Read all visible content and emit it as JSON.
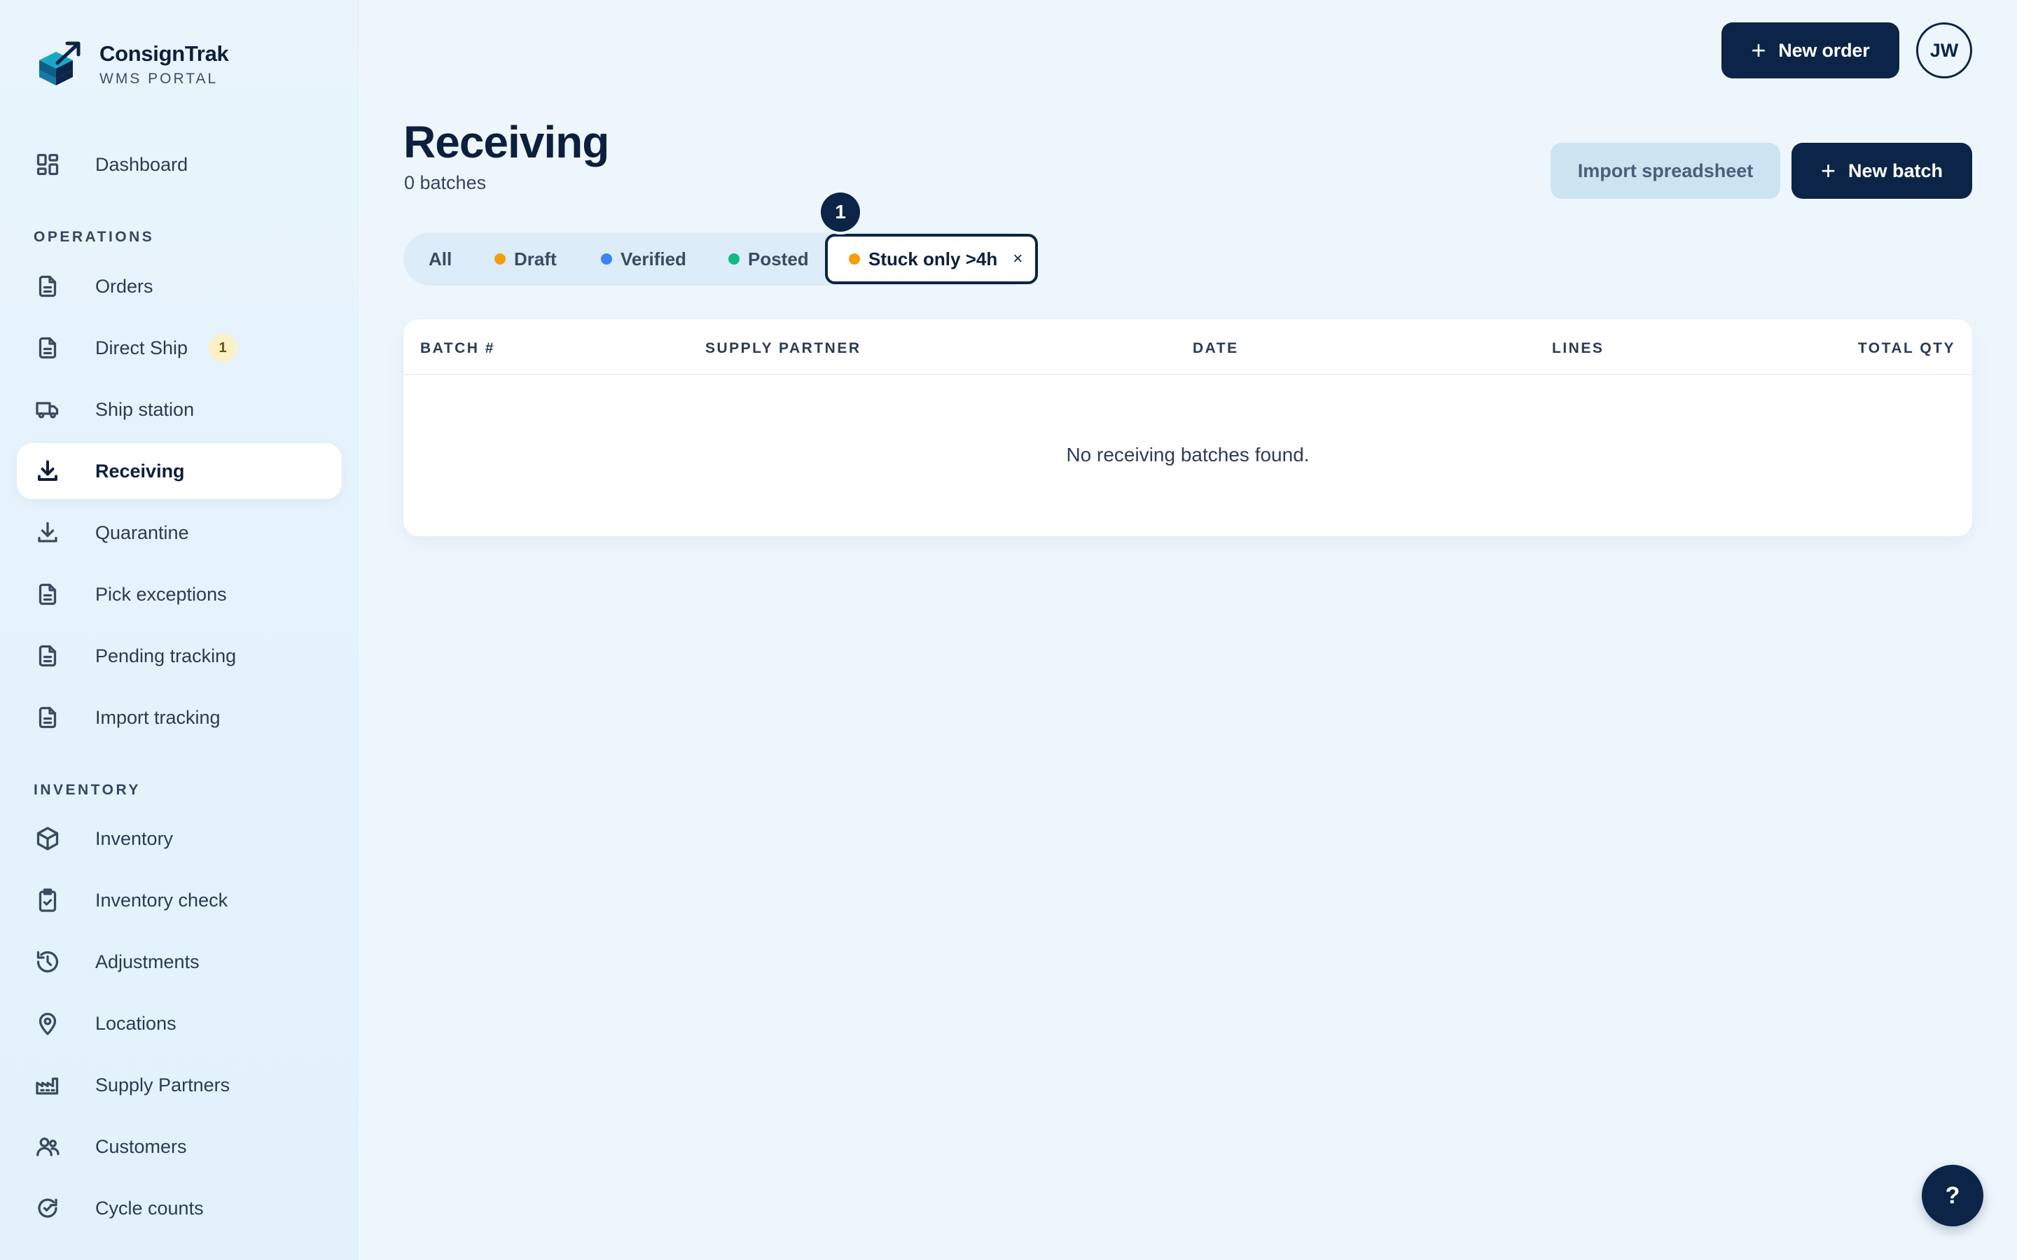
{
  "brand": {
    "name": "ConsignTrak",
    "subtitle": "WMS PORTAL",
    "logo_icon": "stacked-box-arrow-logo"
  },
  "sidebar": {
    "top_items": [
      {
        "label": "Dashboard",
        "icon": "dashboard-grid-icon"
      }
    ],
    "sections": [
      {
        "label": "OPERATIONS",
        "items": [
          {
            "label": "Orders",
            "icon": "document-icon"
          },
          {
            "label": "Direct Ship",
            "icon": "document-icon",
            "badge": "1"
          },
          {
            "label": "Ship station",
            "icon": "truck-icon"
          },
          {
            "label": "Receiving",
            "icon": "download-tray-icon",
            "active": true
          },
          {
            "label": "Quarantine",
            "icon": "download-tray-icon"
          },
          {
            "label": "Pick exceptions",
            "icon": "document-icon"
          },
          {
            "label": "Pending tracking",
            "icon": "document-icon"
          },
          {
            "label": "Import tracking",
            "icon": "document-icon"
          }
        ]
      },
      {
        "label": "INVENTORY",
        "items": [
          {
            "label": "Inventory",
            "icon": "cube-icon"
          },
          {
            "label": "Inventory check",
            "icon": "clipboard-check-icon"
          },
          {
            "label": "Adjustments",
            "icon": "history-icon"
          },
          {
            "label": "Locations",
            "icon": "map-pin-icon"
          },
          {
            "label": "Supply Partners",
            "icon": "factory-icon"
          },
          {
            "label": "Customers",
            "icon": "users-icon"
          },
          {
            "label": "Cycle counts",
            "icon": "refresh-check-icon"
          }
        ]
      }
    ]
  },
  "topbar": {
    "new_order_label": "New order",
    "avatar_initials": "JW"
  },
  "page": {
    "title": "Receiving",
    "subtitle": "0 batches",
    "import_label": "Import spreadsheet",
    "new_batch_label": "New batch"
  },
  "filters": {
    "tabs": [
      {
        "label": "All"
      },
      {
        "label": "Draft",
        "dot_color": "#f59e0b"
      },
      {
        "label": "Verified",
        "dot_color": "#3b82f6"
      },
      {
        "label": "Posted",
        "dot_color": "#10b981"
      }
    ],
    "active_filter": {
      "label": "Stuck only >4h",
      "dot_color": "#f59e0b",
      "close": "×"
    },
    "step_badge": "1"
  },
  "table": {
    "columns": [
      "BATCH #",
      "SUPPLY PARTNER",
      "DATE",
      "LINES",
      "TOTAL QTY"
    ],
    "rows": [],
    "empty_message": "No receiving batches found."
  },
  "help_label": "?",
  "colors": {
    "primary": "#0b2447",
    "background": "#eef6fd",
    "draft": "#f59e0b",
    "verified": "#3b82f6",
    "posted": "#10b981"
  }
}
